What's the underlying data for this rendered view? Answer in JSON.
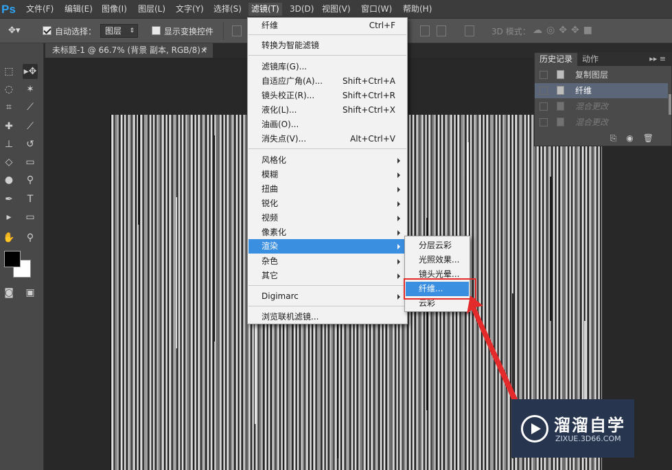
{
  "app": {
    "logo": "Ps"
  },
  "menubar": {
    "items": [
      "文件(F)",
      "编辑(E)",
      "图像(I)",
      "图层(L)",
      "文字(Y)",
      "选择(S)",
      "滤镜(T)",
      "3D(D)",
      "视图(V)",
      "窗口(W)",
      "帮助(H)"
    ],
    "active": "滤镜(T)"
  },
  "options_bar": {
    "auto_select_label": "自动选择：",
    "auto_select_checked": true,
    "auto_select_value": "图层",
    "show_transform_label": "显示变换控件",
    "show_transform_checked": false,
    "mode_3d_label": "3D 模式："
  },
  "document_tab": {
    "title": "未标题-1 @ 66.7% (背景 副本, RGB/8) *",
    "close": "×"
  },
  "history_panel": {
    "tabs": [
      "历史记录",
      "动作"
    ],
    "rows": [
      {
        "label": "复制图层",
        "state": "normal"
      },
      {
        "label": "纤维",
        "state": "selected"
      },
      {
        "label": "混合更改",
        "state": "dimmed"
      },
      {
        "label": "混合更改",
        "state": "dimmed"
      }
    ]
  },
  "filter_menu": {
    "items": [
      {
        "label": "纤维",
        "shortcut": "Ctrl+F"
      },
      {
        "label": "转换为智能滤镜"
      },
      {
        "label": "滤镜库(G)..."
      },
      {
        "label": "自适应广角(A)...",
        "shortcut": "Shift+Ctrl+A"
      },
      {
        "label": "镜头校正(R)...",
        "shortcut": "Shift+Ctrl+R"
      },
      {
        "label": "液化(L)...",
        "shortcut": "Shift+Ctrl+X"
      },
      {
        "label": "油画(O)..."
      },
      {
        "label": "消失点(V)...",
        "shortcut": "Alt+Ctrl+V"
      },
      {
        "label": "风格化",
        "submenu": true
      },
      {
        "label": "模糊",
        "submenu": true
      },
      {
        "label": "扭曲",
        "submenu": true
      },
      {
        "label": "锐化",
        "submenu": true
      },
      {
        "label": "视频",
        "submenu": true
      },
      {
        "label": "像素化",
        "submenu": true
      },
      {
        "label": "渲染",
        "submenu": true,
        "highlighted": true
      },
      {
        "label": "杂色",
        "submenu": true
      },
      {
        "label": "其它",
        "submenu": true
      },
      {
        "label": "Digimarc",
        "submenu": true
      },
      {
        "label": "浏览联机滤镜..."
      }
    ]
  },
  "render_submenu": {
    "items": [
      "分层云彩",
      "光照效果...",
      "镜头光晕...",
      "纤维...",
      "云彩"
    ],
    "highlighted": "纤维..."
  },
  "watermark": {
    "title": "溜溜自学",
    "subtitle": "ZIXUE.3D66.COM"
  },
  "colors": {
    "menu_highlight": "#3a8fe0",
    "annotation_red": "#e32b2b",
    "ps_blue": "#2fa3f5"
  }
}
